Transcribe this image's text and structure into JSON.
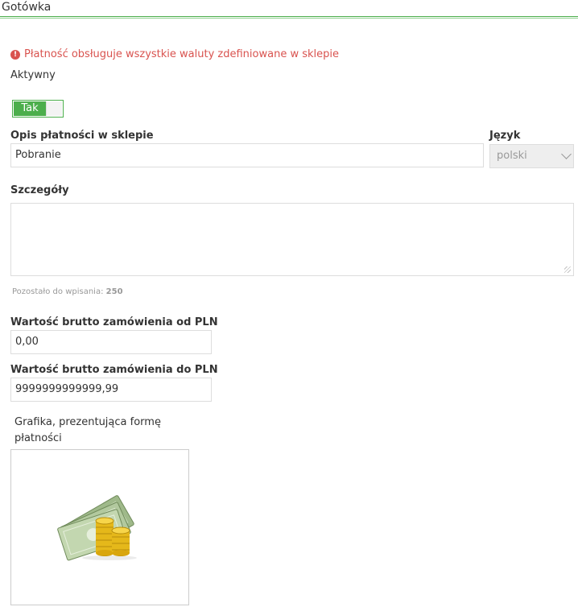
{
  "header": {
    "title": "Gotówka"
  },
  "info": {
    "message": "Płatność obsługuje wszystkie waluty zdefiniowane w sklepie",
    "icon": "exclamation-circle-icon"
  },
  "active": {
    "label": "Aktywny",
    "toggle_label": "Tak",
    "toggle_state": true
  },
  "description": {
    "label": "Opis płatności w sklepie",
    "value": "Pobranie"
  },
  "language": {
    "label": "Język",
    "selected": "polski"
  },
  "details": {
    "label": "Szczegóły",
    "value": "",
    "counter_prefix": "Pozostało do wpisania:",
    "counter_value": "250"
  },
  "min_value": {
    "label": "Wartość brutto zamówienia od PLN",
    "value": "0,00"
  },
  "max_value": {
    "label": "Wartość brutto zamówienia do PLN",
    "value": "9999999999999,99"
  },
  "graphic": {
    "label_line1": "Grafika, prezentująca formę",
    "label_line2": "płatności",
    "image": "money-cash-icon"
  },
  "colors": {
    "accent": "#4cae4c",
    "alert": "#d9534f"
  }
}
